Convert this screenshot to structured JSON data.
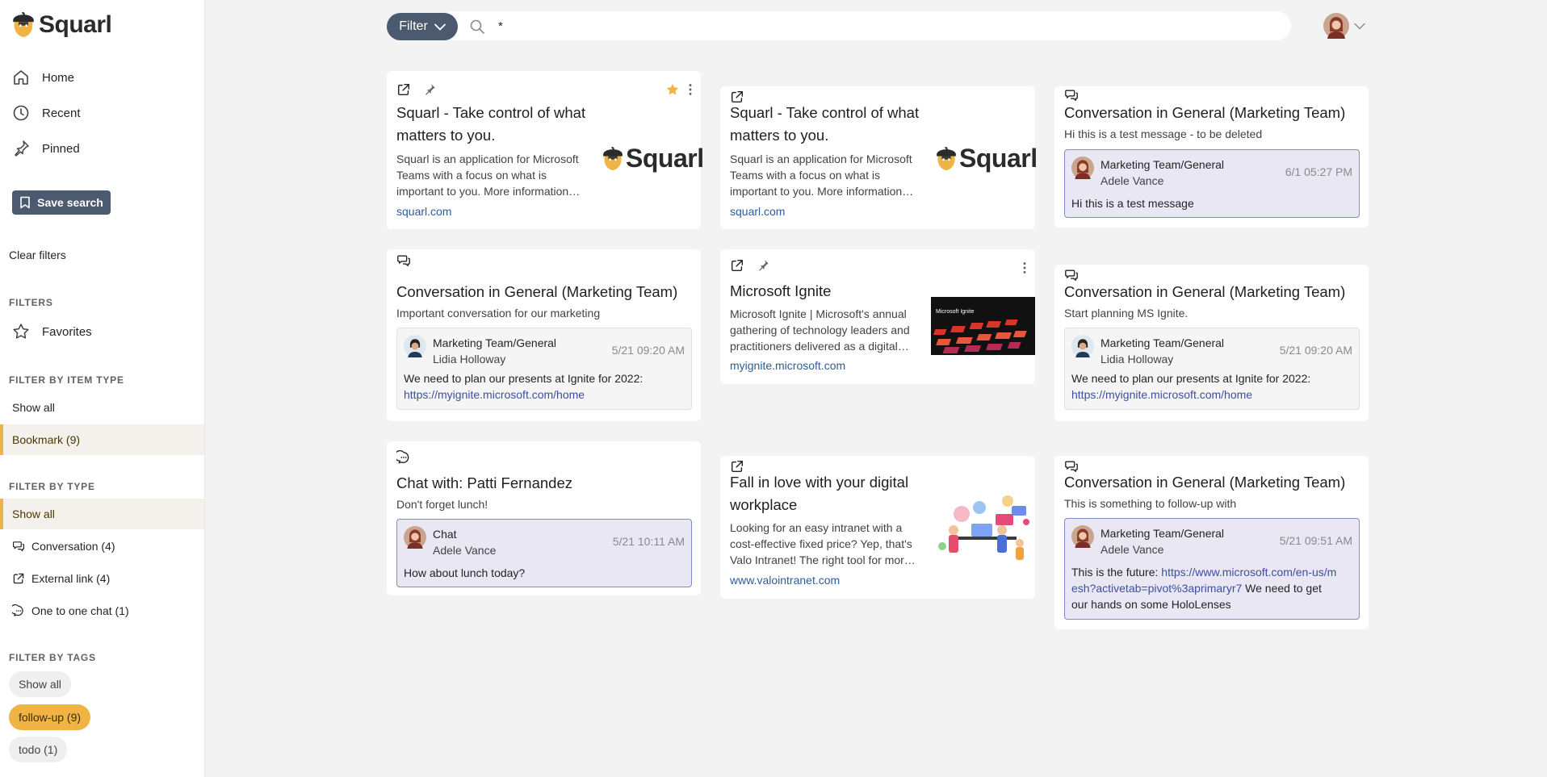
{
  "app": {
    "name": "Squarl"
  },
  "sidebar": {
    "nav": [
      {
        "label": "Home",
        "icon": "home-icon"
      },
      {
        "label": "Recent",
        "icon": "clock-icon"
      },
      {
        "label": "Pinned",
        "icon": "pin-icon"
      }
    ],
    "save_search": "Save search",
    "clear_filters": "Clear filters",
    "filters_heading": "FILTERS",
    "favorites": "Favorites",
    "item_type_heading": "FILTER BY ITEM TYPE",
    "item_type": [
      "Show all",
      "Bookmark (9)"
    ],
    "type_heading": "FILTER BY TYPE",
    "type": [
      "Show all",
      "Conversation (4)",
      "External link (4)",
      "One to one chat (1)"
    ],
    "tags_heading": "FILTER BY TAGS",
    "tags": [
      "Show all",
      "follow-up (9)",
      "todo (1)"
    ]
  },
  "topbar": {
    "filter_label": "Filter",
    "search_value": "*"
  },
  "colors": {
    "accent": "#f0b445",
    "primary": "#4b5a6f",
    "link": "#2e5c9a"
  },
  "cards": {
    "c1": {
      "title_line1": "Squarl - Take control of what",
      "title_line2": "matters to you.",
      "desc": "Squarl is an application for Microsoft Teams with a focus on what is important to you. More information…",
      "link": "squarl.com",
      "logo_text": "Squarl"
    },
    "c2": {
      "title_line1": "Squarl - Take control of what",
      "title_line2": "matters to you.",
      "desc": "Squarl is an application for Microsoft Teams with a focus on what is important to you. More information…",
      "link": "squarl.com",
      "logo_text": "Squarl"
    },
    "c3": {
      "title": "Conversation in General (Marketing Team)",
      "subtitle": "Hi this is a test message - to be deleted",
      "team": "Marketing Team/General",
      "person": "Adele Vance",
      "time": "6/1 05:27 PM",
      "body": "Hi this is a test message"
    },
    "c4": {
      "title": "Conversation in General (Marketing Team)",
      "subtitle": "Important conversation for our marketing",
      "team": "Marketing Team/General",
      "person": "Lidia Holloway",
      "time": "5/21 09:20 AM",
      "body": "We need to plan our presents at Ignite for 2022:",
      "body_link": "https://myignite.microsoft.com/home"
    },
    "c5": {
      "title": "Microsoft Ignite",
      "desc": "Microsoft Ignite | Microsoft's annual gathering of technology leaders and practitioners delivered as a digital…",
      "link": "myignite.microsoft.com",
      "thumb_text": "Microsoft Ignite"
    },
    "c6": {
      "title": "Conversation in General (Marketing Team)",
      "subtitle": "Start planning MS Ignite.",
      "team": "Marketing Team/General",
      "person": "Lidia Holloway",
      "time": "5/21 09:20 AM",
      "body": "We need to plan our presents at Ignite for 2022:",
      "body_link": "https://myignite.microsoft.com/home"
    },
    "c7": {
      "title": "Chat with: Patti Fernandez",
      "subtitle": "Don't forget lunch!",
      "team": "Chat",
      "person": "Adele Vance",
      "time": "5/21 10:11 AM",
      "body": "How about lunch today?"
    },
    "c8": {
      "title_line1": "Fall in love with your digital",
      "title_line2": "workplace",
      "desc": "Looking for an easy intranet with a cost-effective fixed price? Yep, that's Valo Intranet! The right tool for mor…",
      "link": "www.valointranet.com"
    },
    "c9": {
      "title": "Conversation in General (Marketing Team)",
      "subtitle": "This is something to follow-up with",
      "team": "Marketing Team/General",
      "person": "Adele Vance",
      "time": "5/21 09:51 AM",
      "body_pre": "This is the future: ",
      "body_link": "https://www.microsoft.com/en-us/mesh?activetab=pivot%3aprimaryr7",
      "body_post": " We need to get our hands on some HoloLenses"
    }
  }
}
